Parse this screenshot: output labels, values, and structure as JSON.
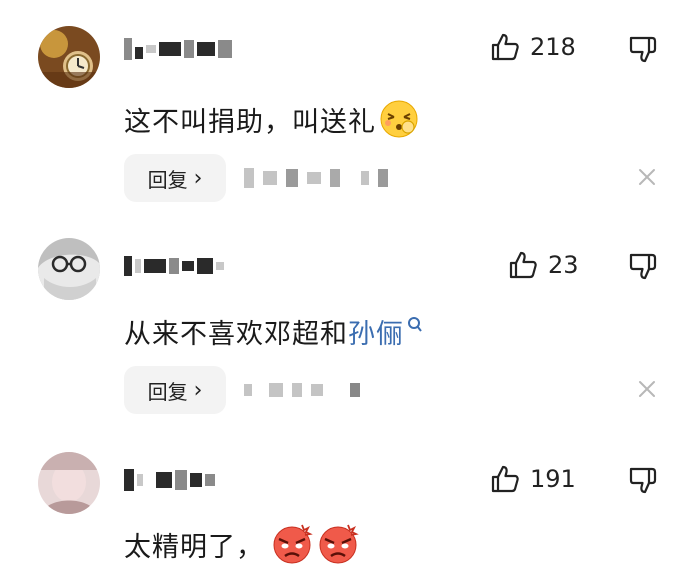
{
  "comments": [
    {
      "like_count": "218",
      "text": "这不叫捐助，叫送礼",
      "reply_label": "回复",
      "reply_chevron": "›",
      "emoji": "blushing-face-emoji",
      "icons": [
        "thumbs-up-icon",
        "thumbs-down-icon",
        "close-icon"
      ]
    },
    {
      "like_count": "23",
      "text_main": "从来不喜欢邓超和",
      "text_link": "孙俪",
      "reply_label": "回复",
      "reply_chevron": "›",
      "icons": [
        "thumbs-up-icon",
        "thumbs-down-icon",
        "search-icon",
        "close-icon"
      ]
    },
    {
      "like_count": "191",
      "text": "太精明了，",
      "emoji": "angry-face-emoji",
      "icons": [
        "thumbs-up-icon",
        "thumbs-down-icon"
      ]
    }
  ],
  "colors": {
    "text": "#1a1a1a",
    "link": "#3b6db0",
    "reply_bg": "#f3f3f3",
    "muted": "#b8b8b8"
  }
}
